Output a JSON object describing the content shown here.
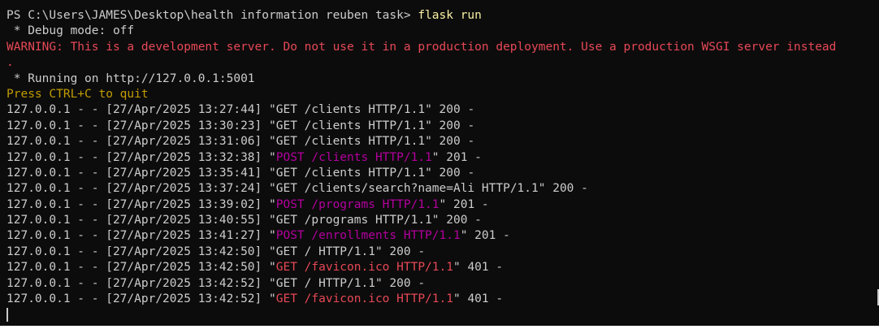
{
  "prompt": {
    "path": "PS C:\\Users\\JAMES\\Desktop\\health information reuben task> ",
    "command": "flask run"
  },
  "debug_line": " * Debug mode: off",
  "warning_line": "WARNING: This is a development server. Do not use it in a production deployment. Use a production WSGI server instead",
  "warning_tail": ".",
  "running_line": " * Running on http://127.0.0.1:5001",
  "quit_line": "Press CTRL+C to quit",
  "log": [
    {
      "prefix": "127.0.0.1 - - [27/Apr/2025 13:27:44] \"",
      "request": "GET /clients HTTP/1.1",
      "suffix": "\" 200 -",
      "kind": "plain"
    },
    {
      "prefix": "127.0.0.1 - - [27/Apr/2025 13:30:23] \"",
      "request": "GET /clients HTTP/1.1",
      "suffix": "\" 200 -",
      "kind": "plain"
    },
    {
      "prefix": "127.0.0.1 - - [27/Apr/2025 13:31:06] \"",
      "request": "GET /clients HTTP/1.1",
      "suffix": "\" 200 -",
      "kind": "plain"
    },
    {
      "prefix": "127.0.0.1 - - [27/Apr/2025 13:32:38] \"",
      "request": "POST /clients HTTP/1.1",
      "suffix": "\" 201 -",
      "kind": "post"
    },
    {
      "prefix": "127.0.0.1 - - [27/Apr/2025 13:35:41] \"",
      "request": "GET /clients HTTP/1.1",
      "suffix": "\" 200 -",
      "kind": "plain"
    },
    {
      "prefix": "127.0.0.1 - - [27/Apr/2025 13:37:24] \"",
      "request": "GET /clients/search?name=Ali HTTP/1.1",
      "suffix": "\" 200 -",
      "kind": "plain"
    },
    {
      "prefix": "127.0.0.1 - - [27/Apr/2025 13:39:02] \"",
      "request": "POST /programs HTTP/1.1",
      "suffix": "\" 201 -",
      "kind": "post"
    },
    {
      "prefix": "127.0.0.1 - - [27/Apr/2025 13:40:55] \"",
      "request": "GET /programs HTTP/1.1",
      "suffix": "\" 200 -",
      "kind": "plain"
    },
    {
      "prefix": "127.0.0.1 - - [27/Apr/2025 13:41:27] \"",
      "request": "POST /enrollments HTTP/1.1",
      "suffix": "\" 201 -",
      "kind": "post"
    },
    {
      "prefix": "127.0.0.1 - - [27/Apr/2025 13:42:50] \"",
      "request": "GET / HTTP/1.1",
      "suffix": "\" 200 -",
      "kind": "plain"
    },
    {
      "prefix": "127.0.0.1 - - [27/Apr/2025 13:42:50] \"",
      "request": "GET /favicon.ico HTTP/1.1",
      "suffix": "\" 401 -",
      "kind": "err"
    },
    {
      "prefix": "127.0.0.1 - - [27/Apr/2025 13:42:52] \"",
      "request": "GET / HTTP/1.1",
      "suffix": "\" 200 -",
      "kind": "plain"
    },
    {
      "prefix": "127.0.0.1 - - [27/Apr/2025 13:42:52] \"",
      "request": "GET /favicon.ico HTTP/1.1",
      "suffix": "\" 401 -",
      "kind": "err"
    }
  ],
  "colors": {
    "background": "#0c0c0c",
    "text": "#cccccc",
    "command": "#f9f1a5",
    "warning": "#e74856",
    "quit": "#c19c00",
    "post": "#b4009e",
    "error_request": "#e74856"
  }
}
